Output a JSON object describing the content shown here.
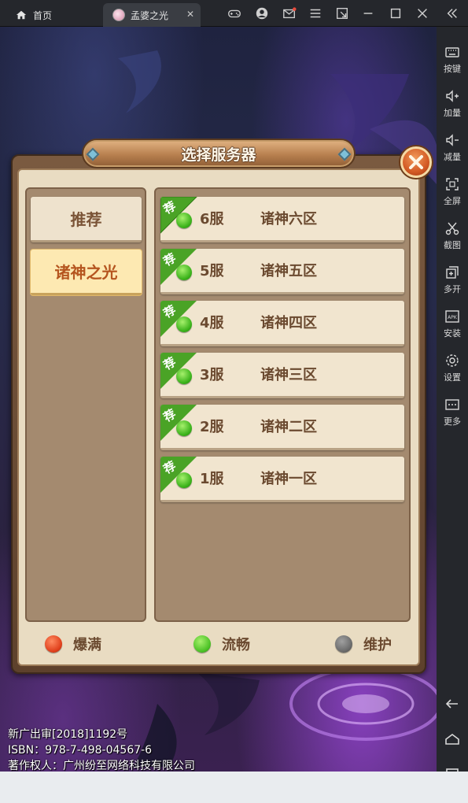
{
  "emulator": {
    "tabs": [
      {
        "label": "首页"
      },
      {
        "label": "孟婆之光"
      }
    ],
    "tab_close": "✕",
    "sidebar": [
      {
        "label": "按键",
        "icon": "keyboard-icon"
      },
      {
        "label": "加量",
        "icon": "volume-up-icon"
      },
      {
        "label": "减量",
        "icon": "volume-down-icon"
      },
      {
        "label": "全屏",
        "icon": "fullscreen-icon"
      },
      {
        "label": "截图",
        "icon": "scissors-icon"
      },
      {
        "label": "多开",
        "icon": "multi-instance-icon"
      },
      {
        "label": "安装",
        "icon": "apk-install-icon"
      },
      {
        "label": "设置",
        "icon": "gear-icon"
      },
      {
        "label": "更多",
        "icon": "more-icon"
      }
    ],
    "apk_text": "APK"
  },
  "dialog": {
    "title": "选择服务器",
    "categories": [
      {
        "label": "推荐",
        "active": false
      },
      {
        "label": "诸神之光",
        "active": true
      }
    ],
    "recommend_badge": "荐",
    "servers": [
      {
        "number": "6服",
        "name": "诸神六区",
        "status": "流畅"
      },
      {
        "number": "5服",
        "name": "诸神五区",
        "status": "流畅"
      },
      {
        "number": "4服",
        "name": "诸神四区",
        "status": "流畅"
      },
      {
        "number": "3服",
        "name": "诸神三区",
        "status": "流畅"
      },
      {
        "number": "2服",
        "name": "诸神二区",
        "status": "流畅"
      },
      {
        "number": "1服",
        "name": "诸神一区",
        "status": "流畅"
      }
    ],
    "legend": [
      {
        "label": "爆满",
        "color": "#e0401c"
      },
      {
        "label": "流畅",
        "color": "#4cc226"
      },
      {
        "label": "维护",
        "color": "#6b6b6b"
      }
    ]
  },
  "copyright": {
    "line1": "新广出审[2018]1192号",
    "line2": "ISBN：978-7-498-04567-6",
    "line3": "著作权人：广州纷至网络科技有限公司"
  },
  "colors": {
    "status_smooth": "#4cc226",
    "status_full": "#e0401c",
    "status_maintenance": "#6b6b6b",
    "badge_green": "#4aa326"
  }
}
